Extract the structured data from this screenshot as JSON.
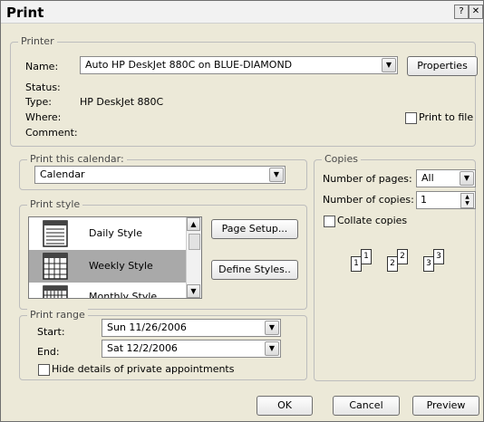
{
  "window": {
    "title": "Print",
    "help_glyph": "?",
    "close_glyph": "✕"
  },
  "printer": {
    "legend": "Printer",
    "name_label": "Name:",
    "name_value": "Auto HP DeskJet 880C on BLUE-DIAMOND",
    "properties_button": "Properties",
    "status_label": "Status:",
    "type_label": "Type:",
    "type_value": "HP DeskJet 880C",
    "where_label": "Where:",
    "comment_label": "Comment:",
    "print_to_file_label": "Print to file"
  },
  "calendar": {
    "legend": "Print this calendar:",
    "value": "Calendar"
  },
  "style": {
    "legend": "Print style",
    "items": [
      {
        "label": "Daily Style",
        "selected": false
      },
      {
        "label": "Weekly Style",
        "selected": true
      },
      {
        "label": "Monthly Style",
        "selected": false
      }
    ],
    "page_setup_button": "Page Setup...",
    "define_styles_button": "Define Styles.."
  },
  "copies": {
    "legend": "Copies",
    "pages_label": "Number of pages:",
    "pages_value": "All",
    "copies_label": "Number of copies:",
    "copies_value": "1",
    "collate_label": "Collate copies",
    "collate_icon_numbers": [
      "1",
      "1",
      "2",
      "2",
      "3",
      "3"
    ]
  },
  "range": {
    "legend": "Print range",
    "start_label": "Start:",
    "start_value": "Sun 11/26/2006",
    "end_label": "End:",
    "end_value": "Sat 12/2/2006",
    "hide_private_label": "Hide details of private appointments"
  },
  "footer": {
    "ok": "OK",
    "cancel": "Cancel",
    "preview": "Preview"
  },
  "icons": {
    "dropdown_arrow": "chevron-down-icon",
    "scroll_up": "scroll-up-icon",
    "scroll_down": "scroll-down-icon",
    "calendar_style": "calendar-icon",
    "spin": "spinner-icon"
  }
}
